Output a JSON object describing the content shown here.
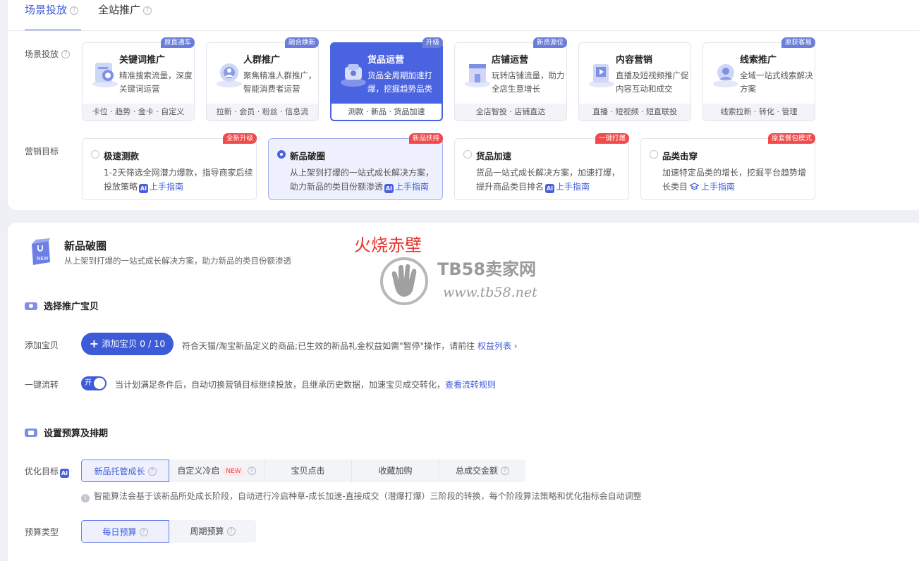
{
  "tabs": [
    {
      "label": "场景投放",
      "active": true
    },
    {
      "label": "全站推广",
      "active": false
    }
  ],
  "scene_label": "场景投放",
  "scenes": [
    {
      "title": "关键词推广",
      "desc": "精准搜索流量，深度关键词运营",
      "foot": "卡位 · 趋势 · 金卡 · 自定义",
      "badge": "原直通车",
      "icon": "magnifier-doc-icon"
    },
    {
      "title": "人群推广",
      "desc": "聚焦精准人群推广，智能消费者运营",
      "foot": "拉新 · 会员 · 粉丝 · 信息流",
      "badge": "融合焕新",
      "icon": "crowd-target-icon"
    },
    {
      "title": "货品运营",
      "desc": "货品全周期加速打爆，挖掘趋势品类",
      "foot": "测款 · 新品 · 货品加速",
      "badge": "升级",
      "icon": "product-box-icon",
      "active": true
    },
    {
      "title": "店铺运营",
      "desc": "玩转店铺流量，助力全店生意增长",
      "foot": "全店智投 · 店铺直达",
      "badge": "新资源位",
      "icon": "shop-icon"
    },
    {
      "title": "内容营销",
      "desc": "直播及短视频推广促内容互动和成交",
      "foot": "直播 · 短视频 · 短直联投",
      "badge": "",
      "icon": "video-content-icon"
    },
    {
      "title": "线索推广",
      "desc": "全域一站式线索解决方案",
      "foot": "线索拉新 · 转化 · 管理",
      "badge": "原获客易",
      "icon": "lead-icon"
    }
  ],
  "goal_label": "营销目标",
  "goals": [
    {
      "title": "极速测款",
      "desc": "1-2天筛选全网潜力爆款，指导商家后续投放策略",
      "guide": "上手指南",
      "badge": "全新升级",
      "mark": "AI"
    },
    {
      "title": "新品破圈",
      "desc": "从上架到打爆的一站式成长解决方案，助力新品的类目份额渗透",
      "guide": "上手指南",
      "badge": "新品扶持",
      "mark": "AI",
      "active": true
    },
    {
      "title": "货品加速",
      "desc": "货品一站式成长解决方案，加速打爆，提升商品类目排名",
      "guide": "上手指南",
      "badge": "一键打爆",
      "mark": "AI"
    },
    {
      "title": "品类击穿",
      "desc": "加速特定品类的增长，挖掘平台趋势增长类目",
      "guide": "上手指南",
      "badge": "原套餐包模式",
      "mark": "hat"
    }
  ],
  "product": {
    "title": "新品破圈",
    "subtitle": "从上架到打爆的一站式成长解决方案，助力新品的类目份额渗透",
    "icon_text": "NEW"
  },
  "section1": {
    "title": "选择推广宝贝"
  },
  "add_item": {
    "label": "添加宝贝",
    "button": "添加宝贝 0 / 10",
    "note": "符合天猫/淘宝新品定义的商品;已生效的新品礼金权益如需\"暂停\"操作，请前往",
    "link": "权益列表"
  },
  "flow": {
    "label": "一键流转",
    "toggle": "开",
    "note": "当计划满足条件后，自动切换营销目标继续投放，且继承历史数据，加速宝贝成交转化，",
    "link": "查看流转规则"
  },
  "section2": {
    "title": "设置预算及排期"
  },
  "optimize": {
    "label": "优化目标",
    "options": [
      "新品托管成长",
      "自定义冷启",
      "宝贝点击",
      "收藏加购",
      "总成交金额"
    ],
    "new_tag": "NEW",
    "info": "智能算法会基于该新品所处成长阶段，自动进行冷启种草-成长加速-直接成交（潜爆打爆）三阶段的转换，每个阶段算法策略和优化指标会自动调整"
  },
  "budget": {
    "label": "预算类型",
    "options": [
      "每日预算",
      "周期预算"
    ]
  },
  "watermark": {
    "red": "火烧赤壁",
    "brand": "TB58卖家网",
    "url": "www.tb58.net"
  },
  "colors": {
    "accent": "#3d5bd9",
    "badge_red": "#f04a4a",
    "badge_blue": "#6b7ddb"
  }
}
